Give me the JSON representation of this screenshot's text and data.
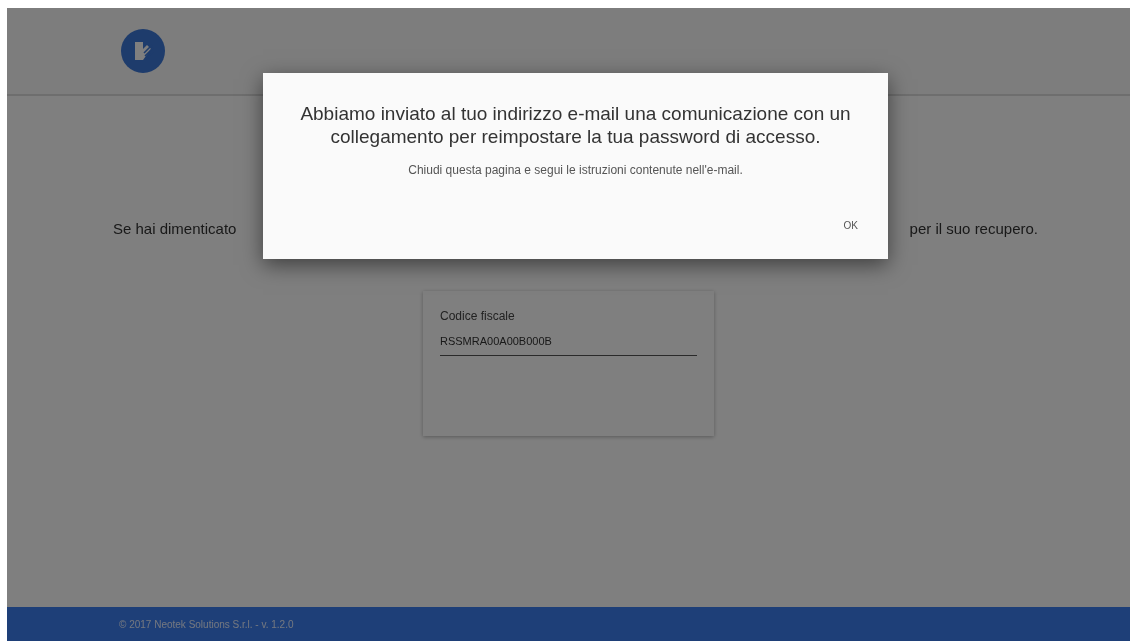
{
  "intro": {
    "left": "Se hai dimenticato",
    "right": "per il suo recupero."
  },
  "form": {
    "field": {
      "label": "Codice fiscale",
      "value": "RSSMRA00A00B000B"
    }
  },
  "dialog": {
    "title": "Abbiamo inviato al tuo indirizzo e-mail una comunicazione con un collegamento per reimpostare la tua password di accesso.",
    "message": "Chiudi questa pagina e segui le istruzioni contenute nell'e-mail.",
    "buttons": [
      "OK"
    ]
  },
  "footer": {
    "text": "© 2017 Neotek Solutions S.r.l. - v. 1.2.0"
  }
}
